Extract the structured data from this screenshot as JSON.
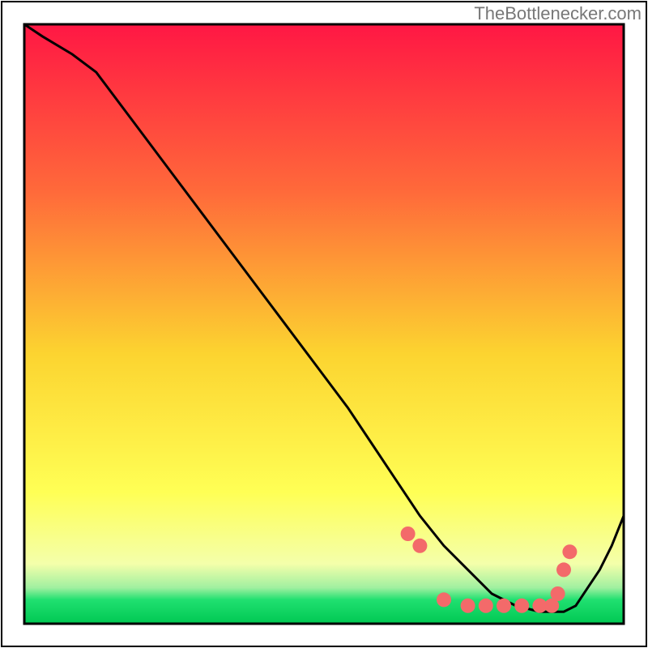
{
  "watermark_text": "TheBottlenecker.com",
  "chart_data": {
    "type": "line",
    "title": "",
    "xlabel": "",
    "ylabel": "",
    "xlim": [
      0,
      100
    ],
    "ylim": [
      0,
      100
    ],
    "background_gradient": {
      "top_color": "#ff1744",
      "mid_upper_color": "#ff6a3a",
      "mid_color": "#fcd430",
      "mid_lower_color": "#ffff55",
      "bottom_band_color": "#20e070",
      "bottom_line_color": "#00c853"
    },
    "series": [
      {
        "name": "curve",
        "x": [
          0,
          3,
          8,
          12,
          18,
          24,
          30,
          36,
          42,
          48,
          54,
          58,
          62,
          66,
          70,
          74,
          78,
          82,
          86,
          88,
          90,
          92,
          94,
          96,
          98,
          100
        ],
        "y": [
          100,
          98,
          95,
          92,
          84,
          76,
          68,
          60,
          52,
          44,
          36,
          30,
          24,
          18,
          13,
          9,
          5,
          3,
          2,
          2,
          2,
          3,
          6,
          9,
          13,
          18
        ]
      }
    ],
    "points": {
      "name": "dots",
      "x": [
        64,
        66,
        70,
        74,
        77,
        80,
        83,
        86,
        88,
        89,
        90,
        91
      ],
      "y": [
        15,
        13,
        4,
        3,
        3,
        3,
        3,
        3,
        3,
        5,
        9,
        12
      ]
    }
  }
}
